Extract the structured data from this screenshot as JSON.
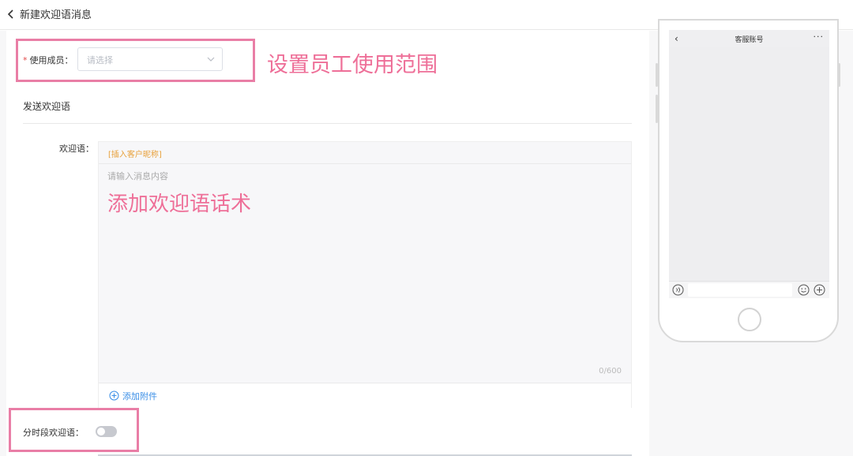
{
  "header": {
    "title": "新建欢迎语消息",
    "back_icon": "chevron-left-icon"
  },
  "form": {
    "members": {
      "required_mark": "*",
      "label": "使用成员：",
      "placeholder": "请选择"
    },
    "section_title": "发送欢迎语",
    "welcome": {
      "label": "欢迎语：",
      "insert_nickname": "[插入客户昵称]",
      "placeholder": "请输入消息内容",
      "counter": "0/600",
      "add_attachment": "添加附件"
    },
    "time_slot": {
      "label": "分时段欢迎语：",
      "enabled": false
    }
  },
  "annotations": {
    "members_note": "设置员工使用范围",
    "welcome_note": "添加欢迎语话术",
    "color": "#ee6f98"
  },
  "phone_preview": {
    "title": "客服账号",
    "back": "‹",
    "more": "···"
  }
}
